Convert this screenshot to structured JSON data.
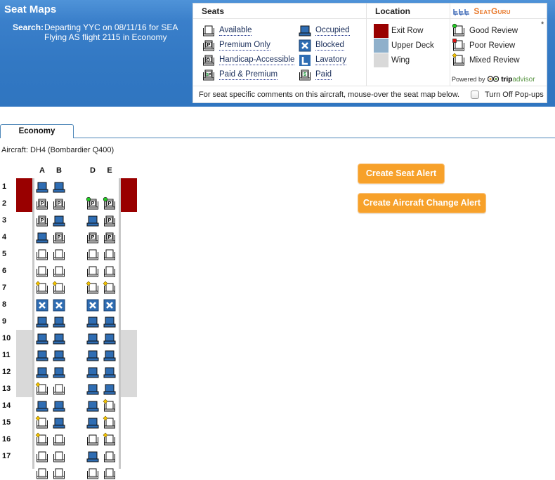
{
  "header": {
    "title": "Seat Maps",
    "search_label": "Search:",
    "search_line1": "Departing YYC on 08/11/16 for SEA",
    "search_line2": "Flying AS flight 2115 in Economy"
  },
  "legend": {
    "seats_heading": "Seats",
    "location_heading": "Location",
    "brand": "SeatGuru",
    "seats_left": [
      {
        "icon": "available",
        "label": "Available"
      },
      {
        "icon": "premium",
        "label": "Premium Only"
      },
      {
        "icon": "handicap",
        "label": "Handicap-Accessible"
      },
      {
        "icon": "paid-premium",
        "label": "Paid & Premium"
      }
    ],
    "seats_right": [
      {
        "icon": "occupied",
        "label": "Occupied"
      },
      {
        "icon": "blocked",
        "label": "Blocked"
      },
      {
        "icon": "lavatory",
        "label": "Lavatory"
      },
      {
        "icon": "paid",
        "label": "Paid"
      }
    ],
    "locations": [
      {
        "label": "Exit Row",
        "color": "#990000"
      },
      {
        "label": "Upper Deck",
        "color": "#8fb0cb"
      },
      {
        "label": "Wing",
        "color": "#d9d9d9"
      }
    ],
    "reviews": [
      {
        "label": "Good Review",
        "marker": "good",
        "color": "#22cc22"
      },
      {
        "label": "Poor Review",
        "marker": "poor",
        "color": "#dd1111"
      },
      {
        "label": "Mixed Review",
        "marker": "mixed",
        "color": "#f5c400"
      }
    ],
    "asterisk": "*",
    "powered_by": "Powered by",
    "tripadvisor_trip": "trip",
    "tripadvisor_advisor": "advisor",
    "footer_text": "For seat specific comments on this aircraft, mouse-over the seat map below.",
    "popups_label": "Turn Off Pop-ups",
    "popups_checked": false
  },
  "tabs": [
    {
      "label": "Economy",
      "active": true
    }
  ],
  "aircraft": "Aircraft: DH4 (Bombardier Q400)",
  "buttons": {
    "seat_alert": "Create Seat Alert",
    "aircraft_change_alert": "Create Aircraft Change Alert"
  },
  "colors": {
    "header_blue": "#3278c3",
    "seat_blue": "#2f6db3",
    "exit_row": "#990000",
    "wing": "#d9d9d9",
    "button_orange": "#f7a12a"
  },
  "seatmap": {
    "columns": [
      "A",
      "B",
      "D",
      "E"
    ],
    "exit_rows": [
      1,
      2
    ],
    "wing_rows": [
      10,
      11,
      12,
      13
    ],
    "rows": [
      {
        "num": "1",
        "seats": [
          "occupied",
          "occupied",
          null,
          null
        ]
      },
      {
        "num": "2",
        "seats": [
          "premium",
          "premium",
          "premium:good",
          "premium:good"
        ]
      },
      {
        "num": "3",
        "seats": [
          "premium",
          "occupied",
          "occupied",
          "premium"
        ]
      },
      {
        "num": "4",
        "seats": [
          "occupied",
          "premium",
          "premium",
          "premium"
        ]
      },
      {
        "num": "5",
        "seats": [
          "available",
          "available",
          "available",
          "available"
        ]
      },
      {
        "num": "6",
        "seats": [
          "available",
          "available",
          "available",
          "available"
        ]
      },
      {
        "num": "7",
        "seats": [
          "available:mixed",
          "available:mixed",
          "available:mixed",
          "available:mixed"
        ]
      },
      {
        "num": "8",
        "seats": [
          "blocked",
          "blocked",
          "blocked",
          "blocked"
        ]
      },
      {
        "num": "9",
        "seats": [
          "occupied",
          "occupied",
          "occupied",
          "occupied"
        ]
      },
      {
        "num": "10",
        "seats": [
          "occupied",
          "occupied",
          "occupied",
          "occupied"
        ]
      },
      {
        "num": "11",
        "seats": [
          "occupied",
          "occupied",
          "occupied",
          "occupied"
        ]
      },
      {
        "num": "12",
        "seats": [
          "occupied",
          "occupied",
          "occupied",
          "occupied"
        ]
      },
      {
        "num": "13",
        "seats": [
          "available:mixed",
          "available",
          "occupied",
          "occupied"
        ]
      },
      {
        "num": "14",
        "seats": [
          "occupied",
          "occupied",
          "occupied",
          "available:mixed"
        ]
      },
      {
        "num": "15",
        "seats": [
          "available:mixed",
          "occupied",
          "occupied",
          "available:mixed"
        ]
      },
      {
        "num": "16",
        "seats": [
          "available:mixed",
          "available",
          "available",
          "available:mixed"
        ]
      },
      {
        "num": "17",
        "seats": [
          "available",
          "available",
          "occupied",
          "available"
        ]
      }
    ]
  }
}
